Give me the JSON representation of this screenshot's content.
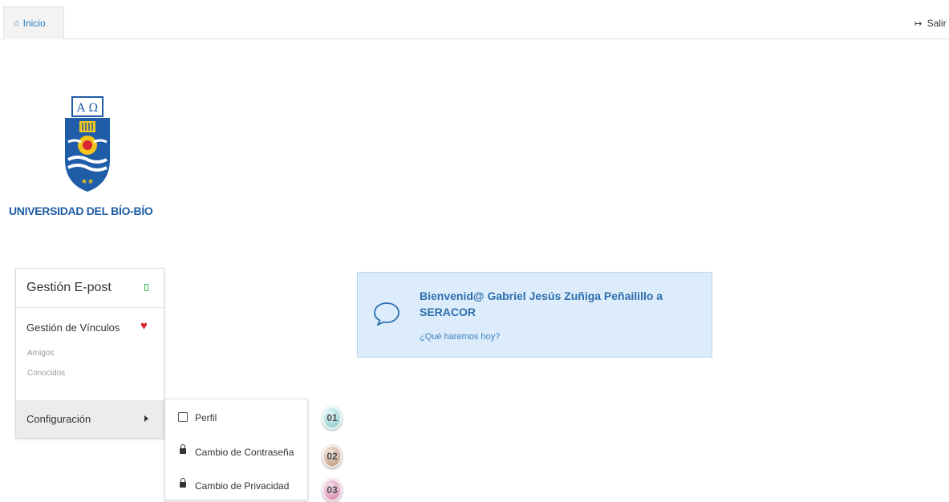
{
  "nav": {
    "home_label": "Inicio",
    "exit_label": "Salir"
  },
  "brand": {
    "university_name": "UNIVERSIDAD DEL BÍO-BÍO",
    "seal_text": "A Ω",
    "colors": {
      "blue": "#1f5da8",
      "yellow": "#f4c51a",
      "red": "#d9273a"
    }
  },
  "sidebar": {
    "header": "Gestión E-post",
    "vinculos": "Gestión de Vínculos",
    "amigos": "Amigos",
    "conocidos": "Conocidos",
    "configuracion": "Configuración"
  },
  "submenu": {
    "items": [
      {
        "label": "Perfil",
        "icon": "edit-icon",
        "badge": "01"
      },
      {
        "label": "Cambio de Contraseña",
        "icon": "lock-icon",
        "badge": "02"
      },
      {
        "label": "Cambio de Privacidad",
        "icon": "lock-icon",
        "badge": "03"
      }
    ]
  },
  "welcome": {
    "title": "Bienvenid@ Gabriel Jesús Zuñiga Peñailillo a SERACOR",
    "subtitle": "¿Qué haremos hoy?",
    "icon": "chat-bubble-icon",
    "accent": "#2d6fae"
  }
}
